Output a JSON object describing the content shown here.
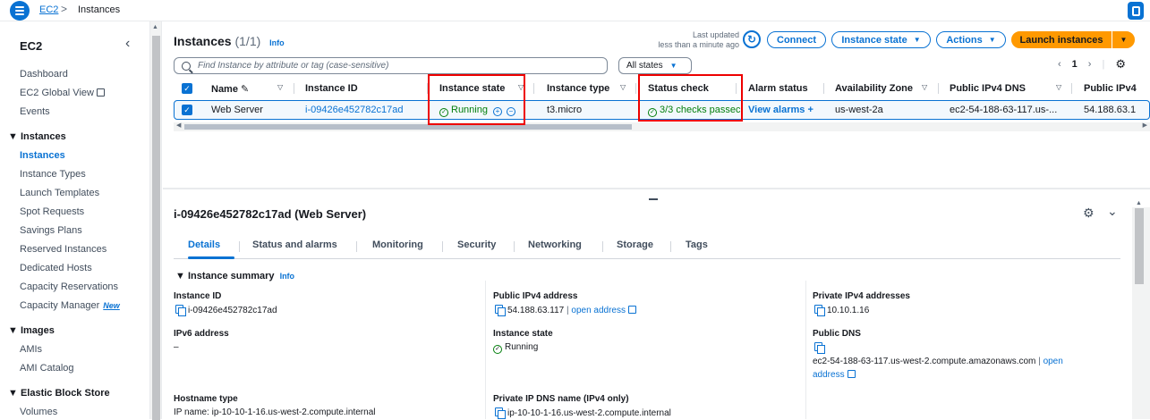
{
  "topbar": {
    "crumb_ec2": "EC2",
    "crumb_current": "Instances",
    "separator": ">"
  },
  "sidebar": {
    "title": "EC2",
    "items": [
      "Dashboard",
      "EC2 Global View",
      "Events"
    ],
    "instances_section": "Instances",
    "instances_items": [
      "Instances",
      "Instance Types",
      "Launch Templates",
      "Spot Requests",
      "Savings Plans",
      "Reserved Instances",
      "Dedicated Hosts",
      "Capacity Reservations",
      "Capacity Manager"
    ],
    "new_badge": "New",
    "images_section": "Images",
    "images_items": [
      "AMIs",
      "AMI Catalog"
    ],
    "ebs_section": "Elastic Block Store",
    "ebs_items": [
      "Volumes"
    ]
  },
  "header": {
    "title": "Instances",
    "count": "(1/1)",
    "info": "Info",
    "last_updated_1": "Last updated",
    "last_updated_2": "less than a minute ago",
    "connect": "Connect",
    "instance_state": "Instance state",
    "actions": "Actions",
    "launch": "Launch instances",
    "search_placeholder": "Find Instance by attribute or tag (case-sensitive)",
    "states_filter": "All states",
    "page": "1"
  },
  "table": {
    "columns": [
      "Name",
      "Instance ID",
      "Instance state",
      "Instance type",
      "Status check",
      "Alarm status",
      "Availability Zone",
      "Public IPv4 DNS",
      "Public IPv4"
    ],
    "row": {
      "name": "Web Server",
      "id": "i-09426e452782c17ad",
      "state": "Running",
      "type": "t3.micro",
      "status": "3/3 checks passec",
      "alarm": "View alarms",
      "az": "us-west-2a",
      "dns": "ec2-54-188-63-117.us-...",
      "ip": "54.188.63.1"
    }
  },
  "details": {
    "title": "i-09426e452782c17ad (Web Server)",
    "tabs": [
      "Details",
      "Status and alarms",
      "Monitoring",
      "Security",
      "Networking",
      "Storage",
      "Tags"
    ],
    "summary_title": "Instance summary",
    "info": "Info",
    "instance_id_label": "Instance ID",
    "instance_id": "i-09426e452782c17ad",
    "public_ipv4_label": "Public IPv4 address",
    "public_ipv4": "54.188.63.117",
    "open_address": "open address",
    "private_ipv4_label": "Private IPv4 addresses",
    "private_ipv4": "10.10.1.16",
    "ipv6_label": "IPv6 address",
    "ipv6": "–",
    "state_label": "Instance state",
    "state": "Running",
    "public_dns_label": "Public DNS",
    "public_dns": "ec2-54-188-63-117.us-west-2.compute.amazonaws.com",
    "open_label": "open",
    "address_label": "address",
    "hostname_label": "Hostname type",
    "hostname": "IP name: ip-10-10-1-16.us-west-2.compute.internal",
    "private_dns_label": "Private IP DNS name (IPv4 only)",
    "private_dns": "ip-10-10-1-16.us-west-2.compute.internal"
  },
  "colors": {
    "accent": "#0972d3",
    "primary": "#ff9900",
    "success": "#037f0c",
    "highlight": "#ee0000"
  }
}
